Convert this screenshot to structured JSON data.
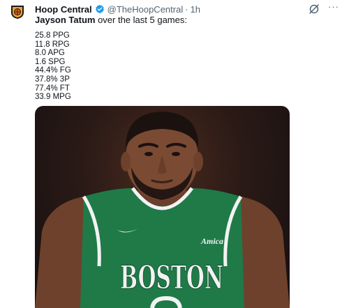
{
  "author": {
    "name": "Hoop Central",
    "handle": "@TheHoopCentral",
    "separator": "·",
    "time": "1h",
    "verified_icon": "verified-badge-icon",
    "avatar_icon": "hoop-central-logo"
  },
  "actions": {
    "grok_icon": "grok-icon",
    "more_label": "···"
  },
  "tweet": {
    "subject": "Jayson Tatum",
    "intro_rest": " over the last 5 games:",
    "stats": [
      "25.8 PPG",
      "11.8 RPG",
      "8.0 APG",
      "1.6 SPG",
      "44.4% FG",
      "37.8% 3P",
      "77.4% FT",
      "33.9 MPG"
    ]
  },
  "photo": {
    "jersey_text": "BOSTON",
    "sponsor_text": "Amica",
    "colors": {
      "jersey": "#1f7a48",
      "jersey_trim": "#f2f2f2",
      "skin": "#7a4a33",
      "background": "#1a1212"
    }
  },
  "colors": {
    "verified": "#1d9bf0",
    "text_primary": "#0f1419",
    "text_secondary": "#536471"
  }
}
